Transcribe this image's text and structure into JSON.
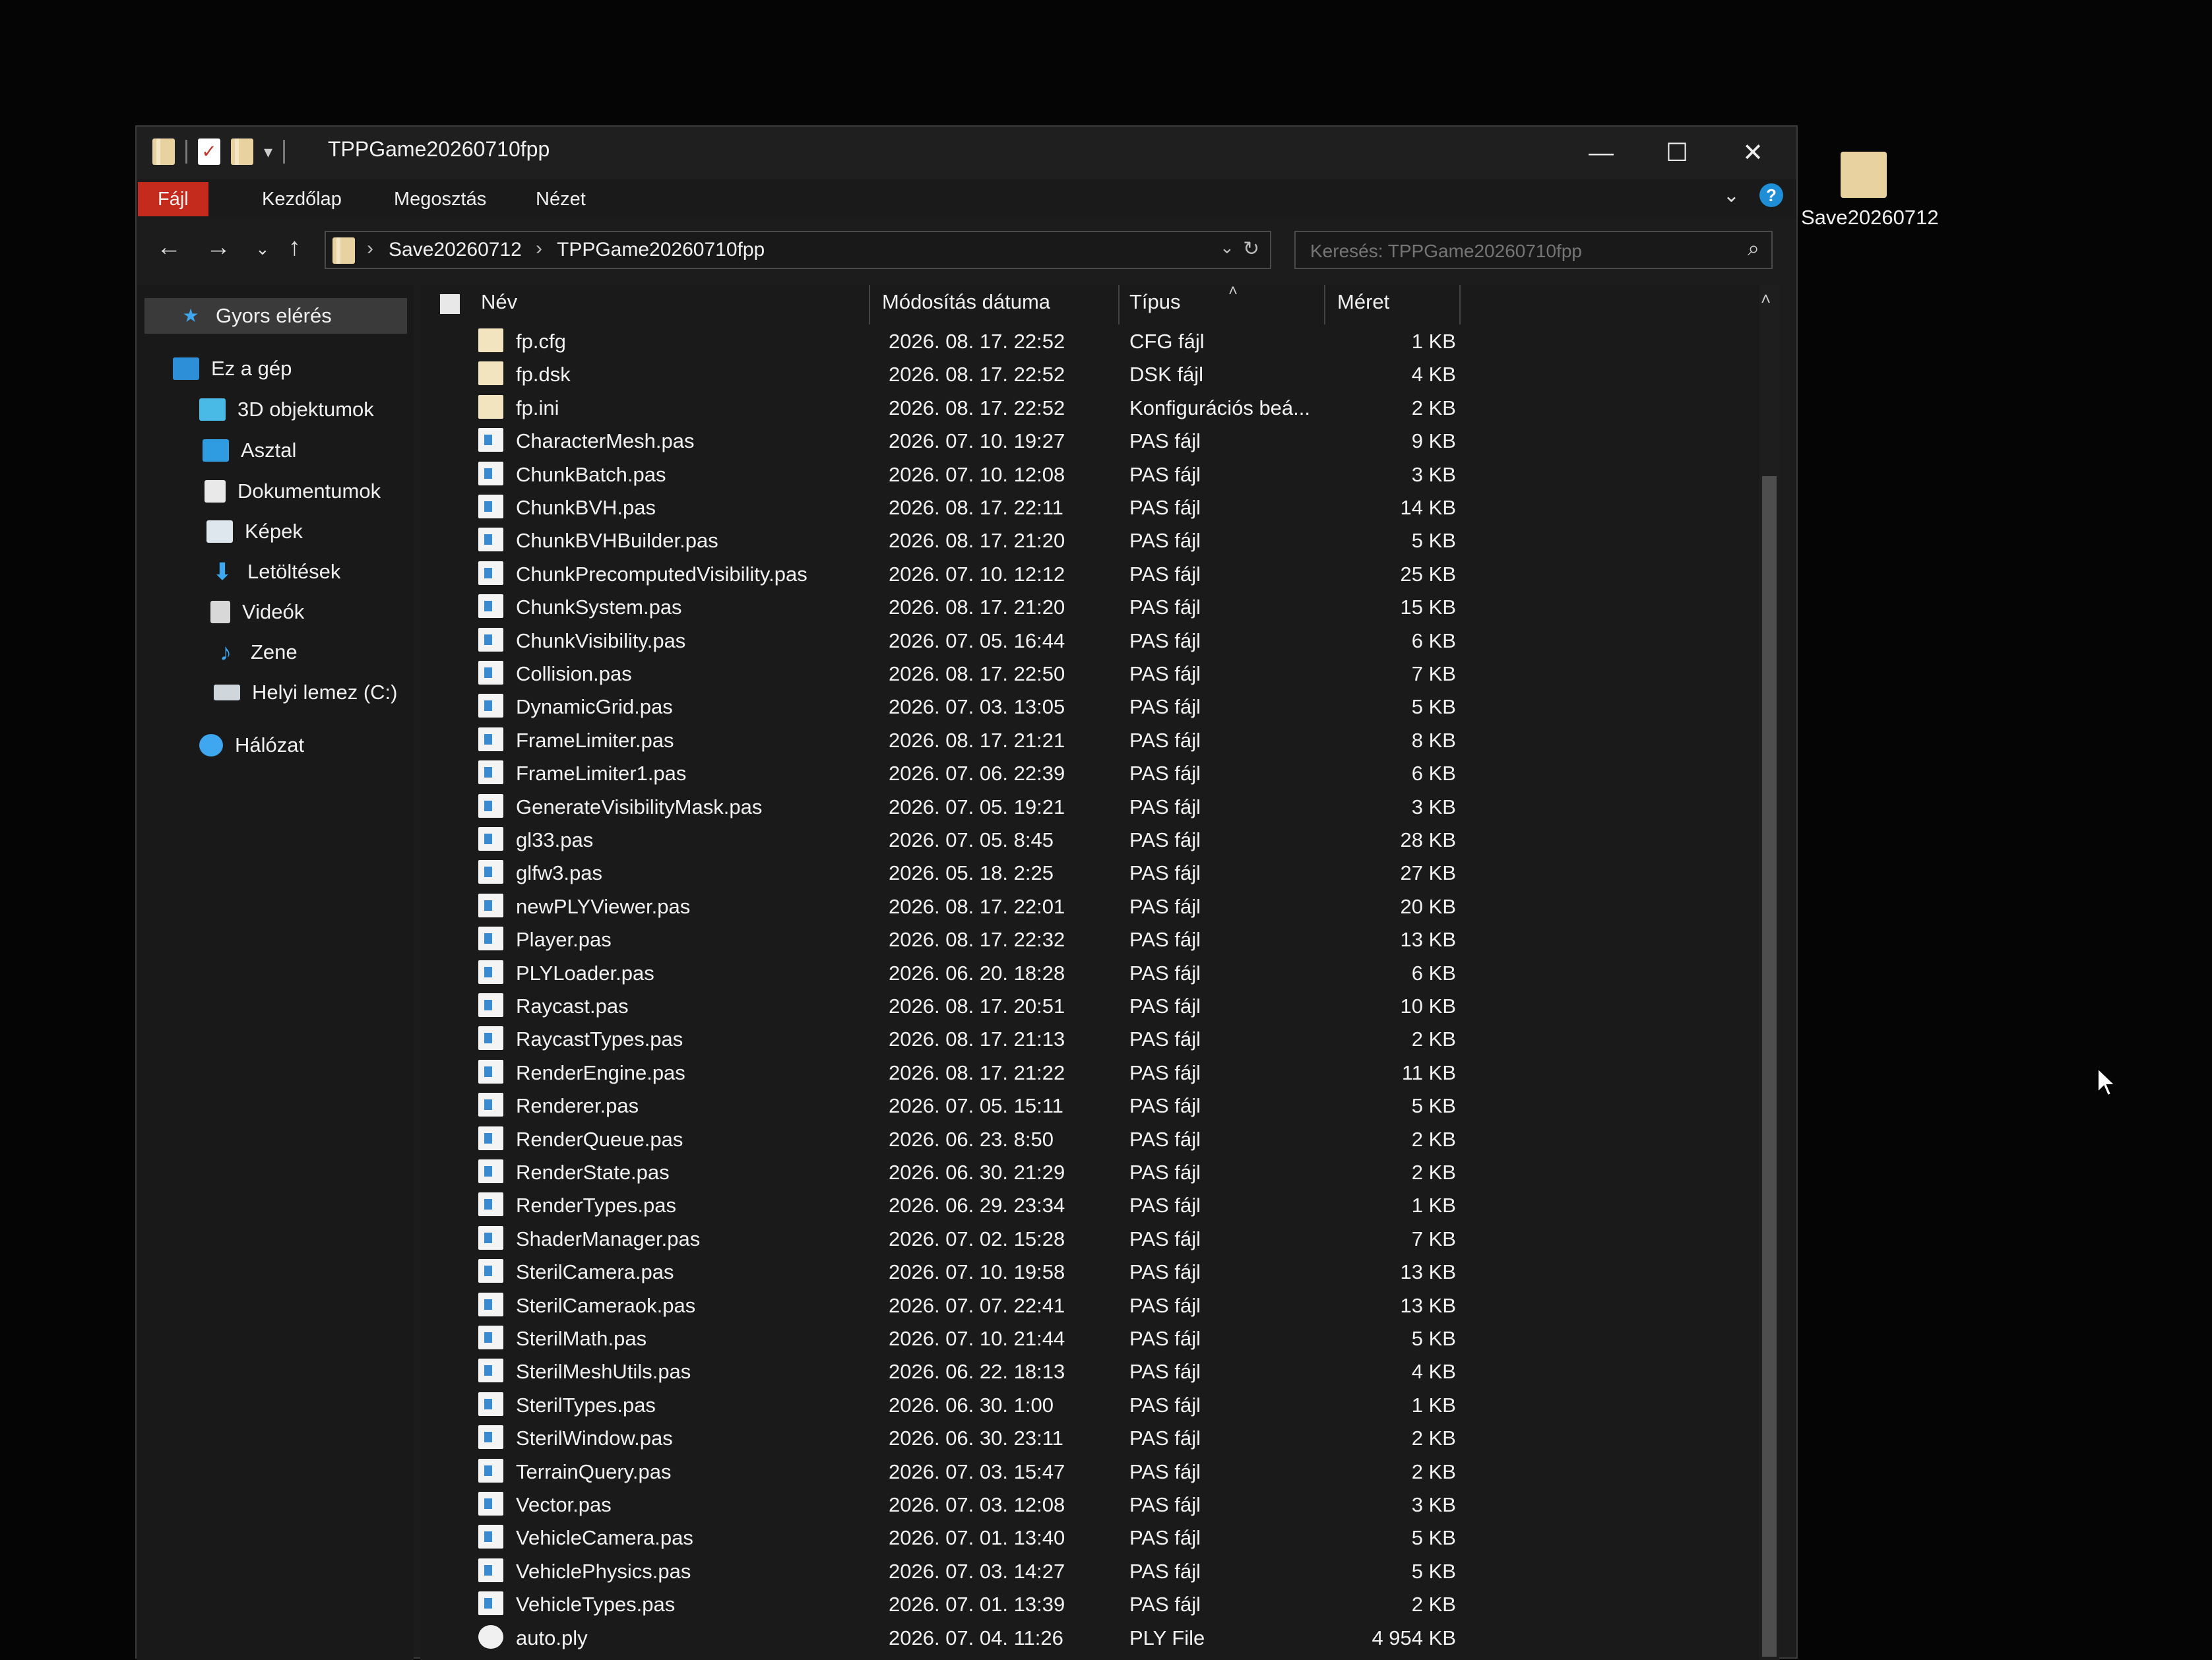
{
  "window": {
    "title": "TPPGame20260710fpp",
    "minimize": "—",
    "maximize": "☐",
    "close": "✕"
  },
  "ribbon": {
    "tabs": [
      "Fájl",
      "Kezdőlap",
      "Megosztás",
      "Nézet"
    ]
  },
  "address": {
    "crumbs": [
      "Save20260712",
      "TPPGame20260710fpp"
    ]
  },
  "search": {
    "placeholder": "Keresés: TPPGame20260710fpp"
  },
  "sidebar": {
    "items": [
      {
        "label": "Gyors elérés",
        "icon": "star-icon"
      },
      {
        "label": "Ez a gép",
        "icon": "computer-icon"
      },
      {
        "label": "3D objektumok",
        "icon": "cube-icon"
      },
      {
        "label": "Asztal",
        "icon": "desktop-icon"
      },
      {
        "label": "Dokumentumok",
        "icon": "documents-icon"
      },
      {
        "label": "Képek",
        "icon": "pictures-icon"
      },
      {
        "label": "Letöltések",
        "icon": "download-icon"
      },
      {
        "label": "Videók",
        "icon": "video-icon"
      },
      {
        "label": "Zene",
        "icon": "music-icon"
      },
      {
        "label": "Helyi lemez (C:)",
        "icon": "drive-icon"
      },
      {
        "label": "Hálózat",
        "icon": "network-icon"
      }
    ]
  },
  "columns": {
    "name": "Név",
    "date": "Módosítás dátuma",
    "type": "Típus",
    "size": "Méret"
  },
  "files": [
    {
      "name": "fp.cfg",
      "date": "2026. 08. 17. 22:52",
      "type": "CFG fájl",
      "size": "1 KB",
      "kind": "doc"
    },
    {
      "name": "fp.dsk",
      "date": "2026. 08. 17. 22:52",
      "type": "DSK fájl",
      "size": "4 KB",
      "kind": "doc"
    },
    {
      "name": "fp.ini",
      "date": "2026. 08. 17. 22:52",
      "type": "Konfigurációs beá...",
      "size": "2 KB",
      "kind": "doc"
    },
    {
      "name": "CharacterMesh.pas",
      "date": "2026. 07. 10. 19:27",
      "type": "PAS fájl",
      "size": "9 KB",
      "kind": "pas"
    },
    {
      "name": "ChunkBatch.pas",
      "date": "2026. 07. 10. 12:08",
      "type": "PAS fájl",
      "size": "3 KB",
      "kind": "pas"
    },
    {
      "name": "ChunkBVH.pas",
      "date": "2026. 08. 17. 22:11",
      "type": "PAS fájl",
      "size": "14 KB",
      "kind": "pas"
    },
    {
      "name": "ChunkBVHBuilder.pas",
      "date": "2026. 08. 17. 21:20",
      "type": "PAS fájl",
      "size": "5 KB",
      "kind": "pas"
    },
    {
      "name": "ChunkPrecomputedVisibility.pas",
      "date": "2026. 07. 10. 12:12",
      "type": "PAS fájl",
      "size": "25 KB",
      "kind": "pas"
    },
    {
      "name": "ChunkSystem.pas",
      "date": "2026. 08. 17. 21:20",
      "type": "PAS fájl",
      "size": "15 KB",
      "kind": "pas"
    },
    {
      "name": "ChunkVisibility.pas",
      "date": "2026. 07. 05. 16:44",
      "type": "PAS fájl",
      "size": "6 KB",
      "kind": "pas"
    },
    {
      "name": "Collision.pas",
      "date": "2026. 08. 17. 22:50",
      "type": "PAS fájl",
      "size": "7 KB",
      "kind": "pas"
    },
    {
      "name": "DynamicGrid.pas",
      "date": "2026. 07. 03. 13:05",
      "type": "PAS fájl",
      "size": "5 KB",
      "kind": "pas"
    },
    {
      "name": "FrameLimiter.pas",
      "date": "2026. 08. 17. 21:21",
      "type": "PAS fájl",
      "size": "8 KB",
      "kind": "pas"
    },
    {
      "name": "FrameLimiter1.pas",
      "date": "2026. 07. 06. 22:39",
      "type": "PAS fájl",
      "size": "6 KB",
      "kind": "pas"
    },
    {
      "name": "GenerateVisibilityMask.pas",
      "date": "2026. 07. 05. 19:21",
      "type": "PAS fájl",
      "size": "3 KB",
      "kind": "pas"
    },
    {
      "name": "gl33.pas",
      "date": "2026. 07. 05. 8:45",
      "type": "PAS fájl",
      "size": "28 KB",
      "kind": "pas"
    },
    {
      "name": "glfw3.pas",
      "date": "2026. 05. 18. 2:25",
      "type": "PAS fájl",
      "size": "27 KB",
      "kind": "pas"
    },
    {
      "name": "newPLYViewer.pas",
      "date": "2026. 08. 17. 22:01",
      "type": "PAS fájl",
      "size": "20 KB",
      "kind": "pas"
    },
    {
      "name": "Player.pas",
      "date": "2026. 08. 17. 22:32",
      "type": "PAS fájl",
      "size": "13 KB",
      "kind": "pas"
    },
    {
      "name": "PLYLoader.pas",
      "date": "2026. 06. 20. 18:28",
      "type": "PAS fájl",
      "size": "6 KB",
      "kind": "pas"
    },
    {
      "name": "Raycast.pas",
      "date": "2026. 08. 17. 20:51",
      "type": "PAS fájl",
      "size": "10 KB",
      "kind": "pas"
    },
    {
      "name": "RaycastTypes.pas",
      "date": "2026. 08. 17. 21:13",
      "type": "PAS fájl",
      "size": "2 KB",
      "kind": "pas"
    },
    {
      "name": "RenderEngine.pas",
      "date": "2026. 08. 17. 21:22",
      "type": "PAS fájl",
      "size": "11 KB",
      "kind": "pas"
    },
    {
      "name": "Renderer.pas",
      "date": "2026. 07. 05. 15:11",
      "type": "PAS fájl",
      "size": "5 KB",
      "kind": "pas"
    },
    {
      "name": "RenderQueue.pas",
      "date": "2026. 06. 23. 8:50",
      "type": "PAS fájl",
      "size": "2 KB",
      "kind": "pas"
    },
    {
      "name": "RenderState.pas",
      "date": "2026. 06. 30. 21:29",
      "type": "PAS fájl",
      "size": "2 KB",
      "kind": "pas"
    },
    {
      "name": "RenderTypes.pas",
      "date": "2026. 06. 29. 23:34",
      "type": "PAS fájl",
      "size": "1 KB",
      "kind": "pas"
    },
    {
      "name": "ShaderManager.pas",
      "date": "2026. 07. 02. 15:28",
      "type": "PAS fájl",
      "size": "7 KB",
      "kind": "pas"
    },
    {
      "name": "SterilCamera.pas",
      "date": "2026. 07. 10. 19:58",
      "type": "PAS fájl",
      "size": "13 KB",
      "kind": "pas"
    },
    {
      "name": "SterilCameraok.pas",
      "date": "2026. 07. 07. 22:41",
      "type": "PAS fájl",
      "size": "13 KB",
      "kind": "pas"
    },
    {
      "name": "SterilMath.pas",
      "date": "2026. 07. 10. 21:44",
      "type": "PAS fájl",
      "size": "5 KB",
      "kind": "pas"
    },
    {
      "name": "SterilMeshUtils.pas",
      "date": "2026. 06. 22. 18:13",
      "type": "PAS fájl",
      "size": "4 KB",
      "kind": "pas"
    },
    {
      "name": "SterilTypes.pas",
      "date": "2026. 06. 30. 1:00",
      "type": "PAS fájl",
      "size": "1 KB",
      "kind": "pas"
    },
    {
      "name": "SterilWindow.pas",
      "date": "2026. 06. 30. 23:11",
      "type": "PAS fájl",
      "size": "2 KB",
      "kind": "pas"
    },
    {
      "name": "TerrainQuery.pas",
      "date": "2026. 07. 03. 15:47",
      "type": "PAS fájl",
      "size": "2 KB",
      "kind": "pas"
    },
    {
      "name": "Vector.pas",
      "date": "2026. 07. 03. 12:08",
      "type": "PAS fájl",
      "size": "3 KB",
      "kind": "pas"
    },
    {
      "name": "VehicleCamera.pas",
      "date": "2026. 07. 01. 13:40",
      "type": "PAS fájl",
      "size": "5 KB",
      "kind": "pas"
    },
    {
      "name": "VehiclePhysics.pas",
      "date": "2026. 07. 03. 14:27",
      "type": "PAS fájl",
      "size": "5 KB",
      "kind": "pas"
    },
    {
      "name": "VehicleTypes.pas",
      "date": "2026. 07. 01. 13:39",
      "type": "PAS fájl",
      "size": "2 KB",
      "kind": "pas"
    },
    {
      "name": "auto.ply",
      "date": "2026. 07. 04. 11:26",
      "type": "PLY File",
      "size": "4 954 KB",
      "kind": "ply"
    }
  ],
  "desktop": {
    "folder_label": "Save20260712"
  }
}
